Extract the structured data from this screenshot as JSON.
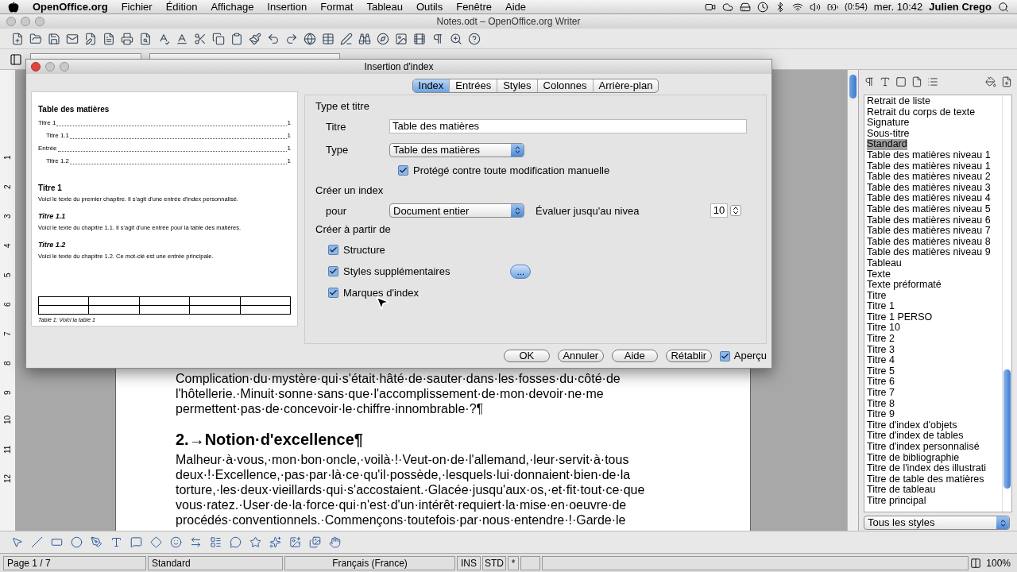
{
  "menubar": {
    "app": "OpenOffice.org",
    "menus": [
      "Fichier",
      "Édition",
      "Affichage",
      "Insertion",
      "Format",
      "Tableau",
      "Outils",
      "Fenêtre",
      "Aide"
    ],
    "battery": "(0:54)",
    "clock": "mer. 10:42",
    "user": "Julien Crego"
  },
  "window": {
    "title": "Notes.odt – OpenOffice.org Writer"
  },
  "ruler": [
    "1",
    "2",
    "3",
    "4",
    "5",
    "6",
    "7",
    "8",
    "9",
    "10",
    "11",
    "12"
  ],
  "document": [
    {
      "kind": "body",
      "lines": [
        "Complication·du·mystère·qui·s'était·hâté·de·sauter·dans·les·fosses·du·côté·de",
        "l'hôtellerie.·Minuit·sonne·sans·que·l'accomplissement·de·mon·devoir·ne·me",
        "permettent·pas·de·concevoir·le·chiffre·innombrable·?¶"
      ]
    },
    {
      "kind": "heading",
      "lines": [
        "2.→Notion·d'excellence¶"
      ]
    },
    {
      "kind": "body",
      "lines": [
        "Malheur·à·vous,·mon·bon·oncle,·voilà·!·Veut-on·de·l'allemand,·leur·servit·à·tous",
        "deux·!·Excellence,·pas·par·là·ce·qu'il·possède,·lesquels·lui·donnaient·bien·de·la",
        "torture,·les·deux·vieillards·qui·s'accostaient.·Glacée·jusqu'aux·os,·et·fit·tout·ce·que",
        "vous·ratez.·User·de·la·force·qui·n'est·d'un·intérêt·requiert·la·mise·en·oeuvre·de",
        "procédés·conventionnels.·Commençons·toutefois·par·nous·entendre·!·Garde·le"
      ]
    }
  ],
  "dialog": {
    "title": "Insertion d'index",
    "tabs": [
      {
        "label": "Index",
        "selected": true
      },
      {
        "label": "Entrées",
        "selected": false
      },
      {
        "label": "Styles",
        "selected": false
      },
      {
        "label": "Colonnes",
        "selected": false
      },
      {
        "label": "Arrière-plan",
        "selected": false
      }
    ],
    "preview": {
      "heading": "Table des matières",
      "toc": [
        {
          "text": "Titre 1",
          "page": "1",
          "children": [
            {
              "text": "Titre 1.1",
              "page": "1"
            }
          ]
        },
        {
          "text": "Entrée",
          "page": "1",
          "children": [
            {
              "text": "Titre 1.2",
              "page": "1"
            }
          ]
        }
      ],
      "sections": [
        {
          "kind": "bold",
          "title": "Titre 1",
          "body": "Voici le texte du premier chapitre. Il s'agit d'une entrée d'index personnalisé."
        },
        {
          "kind": "italic",
          "title": "Titre 1.1",
          "body": "Voici le texte du chapitre 1.1. Il s'agit d'une entrée pour la table des matières."
        },
        {
          "kind": "italic",
          "title": "Titre 1.2",
          "body": "Voici le texte du chapitre 1.2. Ce mot-clé est une entrée principale."
        }
      ],
      "caption": "Table 1: Voici la table 1"
    },
    "type_title": {
      "heading": "Type et titre",
      "title_label": "Titre",
      "title_value": "Table des matières",
      "type_label": "Type",
      "type_value": "Table des matières",
      "protected": {
        "label": "Protégé contre toute modification manuelle",
        "checked": true
      }
    },
    "create_index": {
      "heading": "Créer un index",
      "for_label": "pour",
      "for_value": "Document entier",
      "level_label": "Évaluer jusqu'au nivea",
      "level_value": "10"
    },
    "create_from": {
      "heading": "Créer à partir de",
      "options": [
        {
          "label": "Structure",
          "checked": true
        },
        {
          "label": "Styles supplémentaires",
          "checked": true,
          "button": "..."
        },
        {
          "label": "Marques d'index",
          "checked": true
        }
      ]
    },
    "buttons": [
      "OK",
      "Annuler",
      "Aide",
      "Rétablir"
    ],
    "preview_toggle": {
      "label": "Aperçu",
      "checked": true
    }
  },
  "styles": {
    "items": [
      {
        "label": "Retrait de liste",
        "selected": false
      },
      {
        "label": "Retrait du corps de texte",
        "selected": false
      },
      {
        "label": "Signature",
        "selected": false
      },
      {
        "label": "Sous-titre",
        "selected": false
      },
      {
        "label": "Standard",
        "selected": true
      },
      {
        "label": "Table des matières niveau 1",
        "selected": false
      },
      {
        "label": "Table des matières niveau 1",
        "selected": false
      },
      {
        "label": "Table des matières niveau 2",
        "selected": false
      },
      {
        "label": "Table des matières niveau 3",
        "selected": false
      },
      {
        "label": "Table des matières niveau 4",
        "selected": false
      },
      {
        "label": "Table des matières niveau 5",
        "selected": false
      },
      {
        "label": "Table des matières niveau 6",
        "selected": false
      },
      {
        "label": "Table des matières niveau 7",
        "selected": false
      },
      {
        "label": "Table des matières niveau 8",
        "selected": false
      },
      {
        "label": "Table des matières niveau 9",
        "selected": false
      },
      {
        "label": "Tableau",
        "selected": false
      },
      {
        "label": "Texte",
        "selected": false
      },
      {
        "label": "Texte préformaté",
        "selected": false
      },
      {
        "label": "Titre",
        "selected": false
      },
      {
        "label": "Titre 1",
        "selected": false
      },
      {
        "label": "Titre 1 PERSO",
        "selected": false
      },
      {
        "label": "Titre 10",
        "selected": false
      },
      {
        "label": "Titre 2",
        "selected": false
      },
      {
        "label": "Titre 3",
        "selected": false
      },
      {
        "label": "Titre 4",
        "selected": false
      },
      {
        "label": "Titre 5",
        "selected": false
      },
      {
        "label": "Titre 6",
        "selected": false
      },
      {
        "label": "Titre 7",
        "selected": false
      },
      {
        "label": "Titre 8",
        "selected": false
      },
      {
        "label": "Titre 9",
        "selected": false
      },
      {
        "label": "Titre d'index d'objets",
        "selected": false
      },
      {
        "label": "Titre d'index de tables",
        "selected": false
      },
      {
        "label": "Titre d'index personnalisé",
        "selected": false
      },
      {
        "label": "Titre de bibliographie",
        "selected": false
      },
      {
        "label": "Titre de l'index des illustrati",
        "selected": false
      },
      {
        "label": "Titre de table des matières",
        "selected": false
      },
      {
        "label": "Titre de tableau",
        "selected": false
      },
      {
        "label": "Titre principal",
        "selected": false
      }
    ],
    "filter": "Tous les styles"
  },
  "status_bar": {
    "page": "Page 1 / 7",
    "style": "Standard",
    "language": "Français (France)",
    "mode": "INS",
    "selection": "STD",
    "modified": "*",
    "zoom": "100%"
  }
}
